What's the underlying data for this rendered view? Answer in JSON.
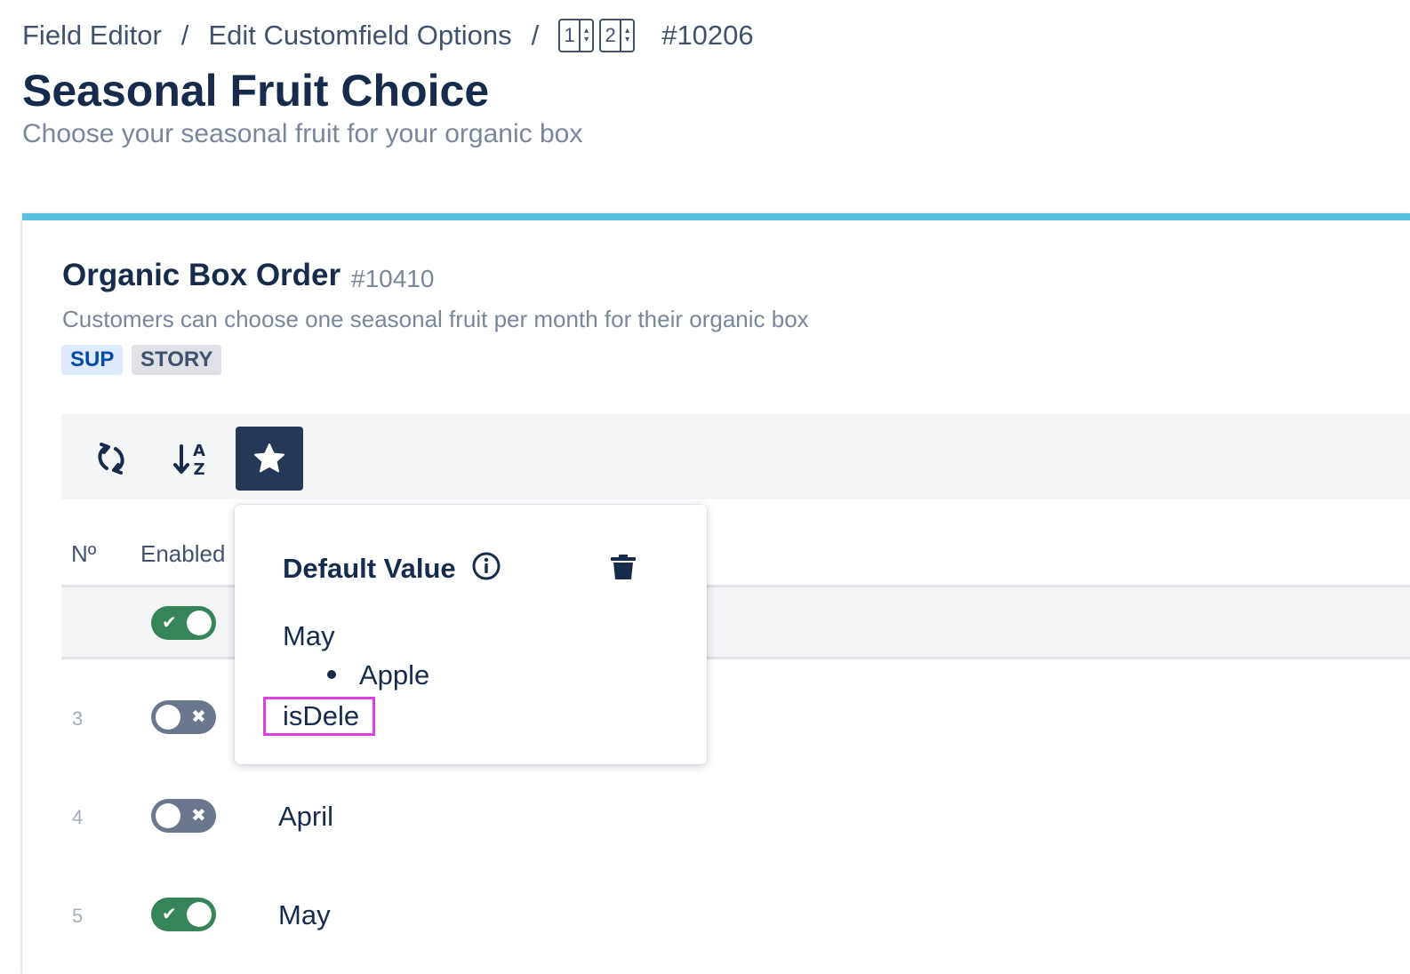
{
  "breadcrumb": {
    "items": [
      "Field Editor",
      "Edit Customfield Options"
    ],
    "separator": "/",
    "stepper": [
      {
        "value": "1"
      },
      {
        "value": "2"
      }
    ],
    "id": "#10206"
  },
  "page": {
    "title": "Seasonal Fruit Choice",
    "subtitle": "Choose your seasonal fruit for your organic box"
  },
  "card": {
    "accent_color": "#5bc0de",
    "title": "Organic Box Order",
    "id": "#10410",
    "description": "Customers can choose one seasonal fruit per month for their organic box",
    "badges": [
      "SUP",
      "STORY"
    ]
  },
  "toolbar": {
    "buttons": [
      {
        "icon": "refresh-icon"
      },
      {
        "icon": "sort-alpha-down-icon"
      },
      {
        "icon": "star-icon",
        "active": true
      }
    ]
  },
  "table": {
    "columns": {
      "number": "Nº",
      "enabled": "Enabled"
    },
    "rows": [
      {
        "number": "",
        "enabled": true,
        "label": ""
      },
      {
        "number": "3",
        "enabled": false,
        "label": ""
      },
      {
        "number": "4",
        "enabled": false,
        "label": "April"
      },
      {
        "number": "5",
        "enabled": true,
        "label": "May"
      }
    ]
  },
  "popover": {
    "title": "Default Value",
    "info_icon": "info-icon",
    "delete_icon": "trash-icon",
    "month": "May",
    "items": [
      "Apple"
    ],
    "error_text": "isDele",
    "error_highlight_color": "#e040e0"
  }
}
